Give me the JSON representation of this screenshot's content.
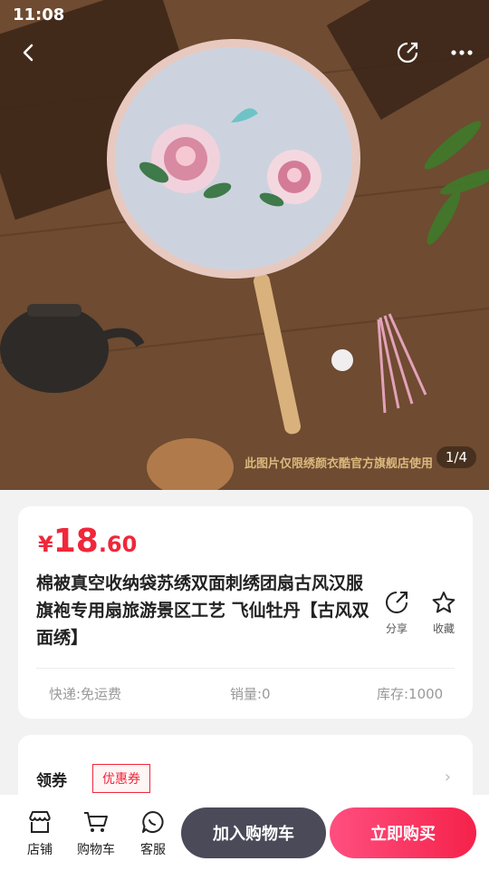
{
  "status": {
    "time": "11:08"
  },
  "gallery": {
    "counter": "1/4",
    "watermark": "此图片仅限绣颜衣酷官方旗舰店使用"
  },
  "product": {
    "currency": "¥",
    "price_int": "18",
    "price_dec": ".60",
    "title": "棉被真空收纳袋苏绣双面刺绣团扇古风汉服旗袍专用扇旅游景区工艺 飞仙牡丹【古风双面绣】",
    "share_label": "分享",
    "favorite_label": "收藏",
    "shipping": "快递:免运费",
    "sales": "销量:0",
    "stock": "库存:1000"
  },
  "coupon": {
    "label": "领券",
    "badge": "优惠券",
    "arrow": "›"
  },
  "bottom_bar": {
    "shop_label": "店铺",
    "cart_label": "购物车",
    "service_label": "客服",
    "add_to_cart": "加入购物车",
    "buy_now": "立即购买"
  },
  "colors": {
    "price_red": "#f0273a",
    "cart_button": "#4a4a59",
    "buy_button": "#f5224a"
  },
  "icons": [
    "back-icon",
    "share-icon",
    "more-icon",
    "star-icon",
    "shop-icon",
    "cart-icon",
    "chat-icon",
    "chevron-right-icon"
  ]
}
